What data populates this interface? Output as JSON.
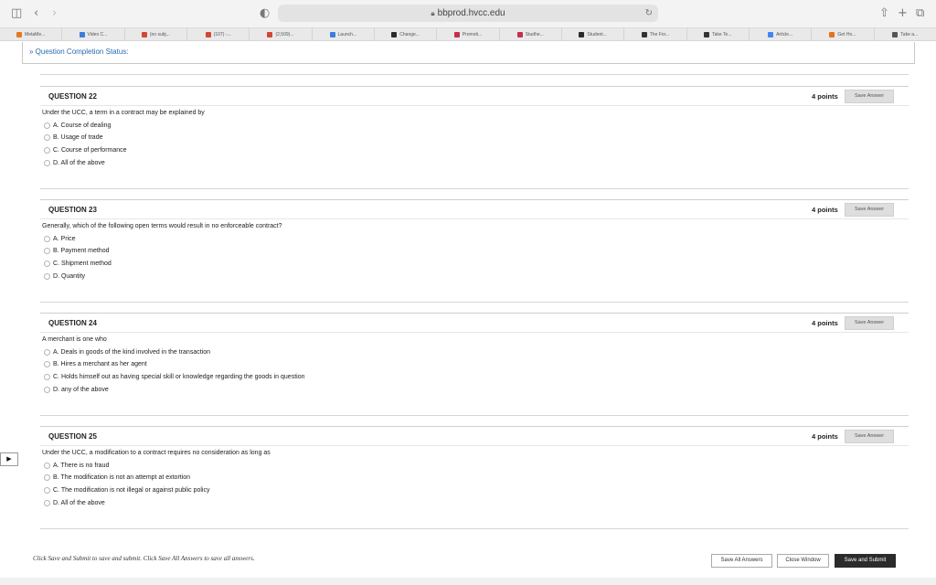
{
  "browser": {
    "url": "bbprod.hvcc.edu",
    "favorites": [
      {
        "label": "MetaMe...",
        "color": "#e07c24"
      },
      {
        "label": "Video C...",
        "color": "#3b7dd8"
      },
      {
        "label": "(no subj...",
        "color": "#d14836"
      },
      {
        "label": "(107) -...",
        "color": "#d14836"
      },
      {
        "label": "(2,509)...",
        "color": "#d14836"
      },
      {
        "label": "Launch...",
        "color": "#3b7dd8"
      },
      {
        "label": "Change...",
        "color": "#2b2b2b"
      },
      {
        "label": "Promoti...",
        "color": "#c62f4b"
      },
      {
        "label": "Studhe...",
        "color": "#c62f4b"
      },
      {
        "label": "Student...",
        "color": "#2b2b2b"
      },
      {
        "label": "The For...",
        "color": "#333333"
      },
      {
        "label": "Take Te...",
        "color": "#333333"
      },
      {
        "label": "Article...",
        "color": "#4285f4"
      },
      {
        "label": "Get Ho...",
        "color": "#e8711c"
      },
      {
        "label": "Take a...",
        "color": "#555555"
      }
    ]
  },
  "status": {
    "label": "» Question Completion Status:"
  },
  "questions": [
    {
      "title": "QUESTION 22",
      "points": "4 points",
      "save_label": "Save Answer",
      "text": "Under the UCC, a term in a contract may be explained by",
      "options": [
        "A. Course of dealing",
        "B. Usage of trade",
        "C. Course of performance",
        "D. All of the above"
      ]
    },
    {
      "title": "QUESTION 23",
      "points": "4 points",
      "save_label": "Save Answer",
      "text": "Generally, which of the following open terms would result in no enforceable contract?",
      "options": [
        "A. Price",
        "B. Payment method",
        "C. Shipment method",
        "D. Quantity"
      ]
    },
    {
      "title": "QUESTION 24",
      "points": "4 points",
      "save_label": "Save Answer",
      "text": "A merchant is one who",
      "options": [
        "A. Deals in goods of the kind involved in the transaction",
        "B. Hires a merchant as her agent",
        "C. Holds himself out as having special skill or knowledge regarding the goods in question",
        "D. any of the above"
      ]
    },
    {
      "title": "QUESTION 25",
      "points": "4 points",
      "save_label": "Save Answer",
      "text": "Under the UCC, a modification to a contract requires no consideration as long as",
      "options": [
        "A. There is no fraud",
        "B. The modification is not an attempt at extortion",
        "C. The modification is not illegal or against public policy",
        "D. All of the above"
      ]
    }
  ],
  "footer": {
    "note": "Click Save and Submit to save and submit. Click Save All Answers to save all answers.",
    "save_all": "Save All Answers",
    "close_window": "Close Window",
    "save_submit": "Save and Submit"
  }
}
